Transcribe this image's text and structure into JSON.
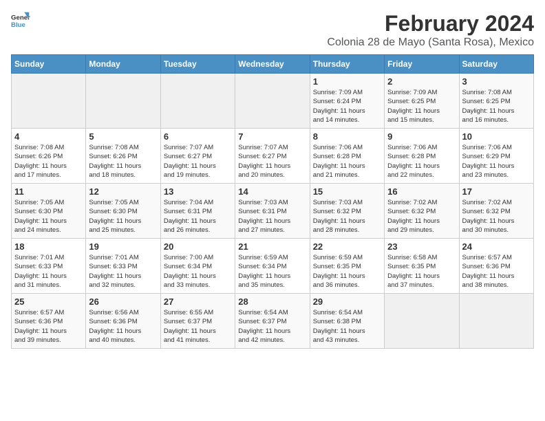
{
  "logo": {
    "line1": "General",
    "line2": "Blue"
  },
  "title": "February 2024",
  "subtitle": "Colonia 28 de Mayo (Santa Rosa), Mexico",
  "days_of_week": [
    "Sunday",
    "Monday",
    "Tuesday",
    "Wednesday",
    "Thursday",
    "Friday",
    "Saturday"
  ],
  "weeks": [
    [
      {
        "day": "",
        "info": ""
      },
      {
        "day": "",
        "info": ""
      },
      {
        "day": "",
        "info": ""
      },
      {
        "day": "",
        "info": ""
      },
      {
        "day": "1",
        "info": "Sunrise: 7:09 AM\nSunset: 6:24 PM\nDaylight: 11 hours\nand 14 minutes."
      },
      {
        "day": "2",
        "info": "Sunrise: 7:09 AM\nSunset: 6:25 PM\nDaylight: 11 hours\nand 15 minutes."
      },
      {
        "day": "3",
        "info": "Sunrise: 7:08 AM\nSunset: 6:25 PM\nDaylight: 11 hours\nand 16 minutes."
      }
    ],
    [
      {
        "day": "4",
        "info": "Sunrise: 7:08 AM\nSunset: 6:26 PM\nDaylight: 11 hours\nand 17 minutes."
      },
      {
        "day": "5",
        "info": "Sunrise: 7:08 AM\nSunset: 6:26 PM\nDaylight: 11 hours\nand 18 minutes."
      },
      {
        "day": "6",
        "info": "Sunrise: 7:07 AM\nSunset: 6:27 PM\nDaylight: 11 hours\nand 19 minutes."
      },
      {
        "day": "7",
        "info": "Sunrise: 7:07 AM\nSunset: 6:27 PM\nDaylight: 11 hours\nand 20 minutes."
      },
      {
        "day": "8",
        "info": "Sunrise: 7:06 AM\nSunset: 6:28 PM\nDaylight: 11 hours\nand 21 minutes."
      },
      {
        "day": "9",
        "info": "Sunrise: 7:06 AM\nSunset: 6:28 PM\nDaylight: 11 hours\nand 22 minutes."
      },
      {
        "day": "10",
        "info": "Sunrise: 7:06 AM\nSunset: 6:29 PM\nDaylight: 11 hours\nand 23 minutes."
      }
    ],
    [
      {
        "day": "11",
        "info": "Sunrise: 7:05 AM\nSunset: 6:30 PM\nDaylight: 11 hours\nand 24 minutes."
      },
      {
        "day": "12",
        "info": "Sunrise: 7:05 AM\nSunset: 6:30 PM\nDaylight: 11 hours\nand 25 minutes."
      },
      {
        "day": "13",
        "info": "Sunrise: 7:04 AM\nSunset: 6:31 PM\nDaylight: 11 hours\nand 26 minutes."
      },
      {
        "day": "14",
        "info": "Sunrise: 7:03 AM\nSunset: 6:31 PM\nDaylight: 11 hours\nand 27 minutes."
      },
      {
        "day": "15",
        "info": "Sunrise: 7:03 AM\nSunset: 6:32 PM\nDaylight: 11 hours\nand 28 minutes."
      },
      {
        "day": "16",
        "info": "Sunrise: 7:02 AM\nSunset: 6:32 PM\nDaylight: 11 hours\nand 29 minutes."
      },
      {
        "day": "17",
        "info": "Sunrise: 7:02 AM\nSunset: 6:32 PM\nDaylight: 11 hours\nand 30 minutes."
      }
    ],
    [
      {
        "day": "18",
        "info": "Sunrise: 7:01 AM\nSunset: 6:33 PM\nDaylight: 11 hours\nand 31 minutes."
      },
      {
        "day": "19",
        "info": "Sunrise: 7:01 AM\nSunset: 6:33 PM\nDaylight: 11 hours\nand 32 minutes."
      },
      {
        "day": "20",
        "info": "Sunrise: 7:00 AM\nSunset: 6:34 PM\nDaylight: 11 hours\nand 33 minutes."
      },
      {
        "day": "21",
        "info": "Sunrise: 6:59 AM\nSunset: 6:34 PM\nDaylight: 11 hours\nand 35 minutes."
      },
      {
        "day": "22",
        "info": "Sunrise: 6:59 AM\nSunset: 6:35 PM\nDaylight: 11 hours\nand 36 minutes."
      },
      {
        "day": "23",
        "info": "Sunrise: 6:58 AM\nSunset: 6:35 PM\nDaylight: 11 hours\nand 37 minutes."
      },
      {
        "day": "24",
        "info": "Sunrise: 6:57 AM\nSunset: 6:36 PM\nDaylight: 11 hours\nand 38 minutes."
      }
    ],
    [
      {
        "day": "25",
        "info": "Sunrise: 6:57 AM\nSunset: 6:36 PM\nDaylight: 11 hours\nand 39 minutes."
      },
      {
        "day": "26",
        "info": "Sunrise: 6:56 AM\nSunset: 6:36 PM\nDaylight: 11 hours\nand 40 minutes."
      },
      {
        "day": "27",
        "info": "Sunrise: 6:55 AM\nSunset: 6:37 PM\nDaylight: 11 hours\nand 41 minutes."
      },
      {
        "day": "28",
        "info": "Sunrise: 6:54 AM\nSunset: 6:37 PM\nDaylight: 11 hours\nand 42 minutes."
      },
      {
        "day": "29",
        "info": "Sunrise: 6:54 AM\nSunset: 6:38 PM\nDaylight: 11 hours\nand 43 minutes."
      },
      {
        "day": "",
        "info": ""
      },
      {
        "day": "",
        "info": ""
      }
    ]
  ]
}
